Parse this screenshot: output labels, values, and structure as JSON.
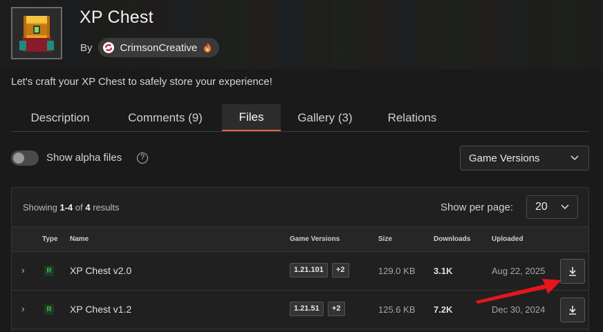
{
  "header": {
    "title": "XP Chest",
    "by_label": "By",
    "author": "CrimsonCreative",
    "tagline": "Let's craft your XP Chest to safely store your experience!"
  },
  "tabs": [
    {
      "label": "Description",
      "active": false
    },
    {
      "label": "Comments (9)",
      "active": false
    },
    {
      "label": "Files",
      "active": true
    },
    {
      "label": "Gallery (3)",
      "active": false
    },
    {
      "label": "Relations",
      "active": false
    }
  ],
  "filters": {
    "alpha_label": "Show alpha files",
    "alpha_enabled": false,
    "help_glyph": "?",
    "game_versions_label": "Game Versions"
  },
  "files": {
    "showing_prefix": "Showing",
    "showing_range": "1-4",
    "showing_of": "of",
    "showing_total": "4",
    "showing_suffix": "results",
    "per_page_label": "Show per page:",
    "per_page_value": "20",
    "columns": [
      "Type",
      "Name",
      "Game Versions",
      "Size",
      "Downloads",
      "Uploaded"
    ],
    "rows": [
      {
        "type": "R",
        "name": "XP Chest v2.0",
        "version": "1.21.101",
        "extra_versions": "+2",
        "size": "129.0 KB",
        "downloads": "3.1K",
        "uploaded": "Aug 22, 2025"
      },
      {
        "type": "R",
        "name": "XP Chest v1.2",
        "version": "1.21.51",
        "extra_versions": "+2",
        "size": "125.6 KB",
        "downloads": "7.2K",
        "uploaded": "Dec 30, 2024"
      }
    ]
  },
  "colors": {
    "accent": "#e4643b",
    "release_badge": "#3fb950",
    "annotation_arrow": "#e8141c"
  },
  "icons": [
    "chest-logo-icon",
    "author-avatar-icon",
    "flame-icon",
    "help-icon",
    "chevron-down-icon",
    "chevron-right-icon",
    "download-icon",
    "annotation-arrow-icon"
  ]
}
